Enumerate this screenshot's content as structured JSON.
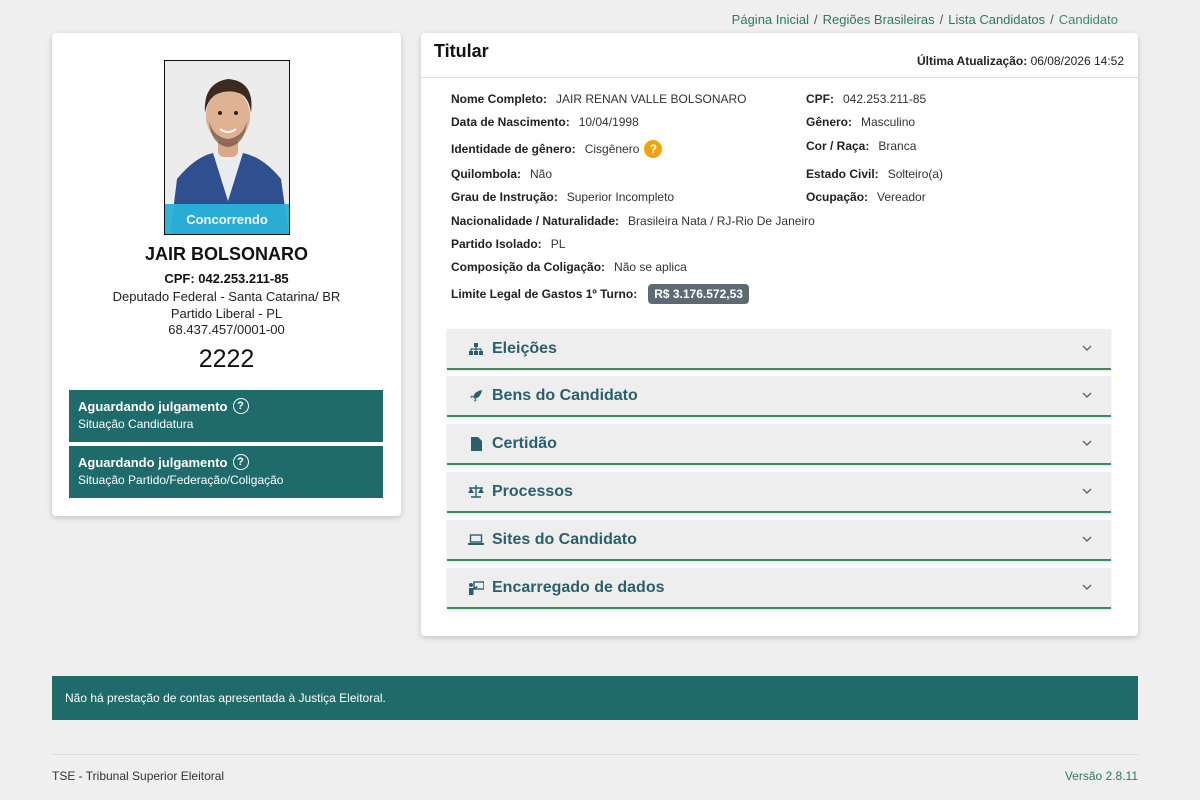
{
  "breadcrumb": {
    "items": [
      "Página Inicial",
      "Regiões Brasileiras",
      "Lista Candidatos",
      "Candidato"
    ],
    "separator": "/"
  },
  "profile": {
    "photo_badge": "Concorrendo",
    "name": "JAIR BOLSONARO",
    "cpf": "CPF: 042.253.211-85",
    "office": "Deputado Federal - Santa Catarina/ BR",
    "party": "Partido Liberal - PL",
    "cnpj": "68.437.457/0001-00",
    "number": "2222",
    "status": [
      {
        "title": "Aguardando julgamento",
        "subtitle": "Situação Candidatura"
      },
      {
        "title": "Aguardando julgamento",
        "subtitle": "Situação Partido/Federação/Coligação"
      }
    ],
    "status_color": "#1f6b6b",
    "badge_color": "#29b3d9"
  },
  "details": {
    "title": "Titular",
    "last_update_label": "Última Atualização:",
    "last_update_value": "06/08/2026 14:52",
    "fields": {
      "nome": {
        "label": "Nome Completo:",
        "value": "JAIR RENAN VALLE BOLSONARO"
      },
      "cpf": {
        "label": "CPF:",
        "value": "042.253.211-85"
      },
      "nascimento": {
        "label": "Data de Nascimento:",
        "value": "10/04/1998"
      },
      "genero": {
        "label": "Gênero:",
        "value": "Masculino"
      },
      "identidade": {
        "label": "Identidade de gênero:",
        "value": "Cisgênero"
      },
      "cor": {
        "label": "Cor / Raça:",
        "value": "Branca"
      },
      "quilombola": {
        "label": "Quilombola:",
        "value": "Não"
      },
      "estado_civil": {
        "label": "Estado Civil:",
        "value": "Solteiro(a)"
      },
      "instrucao": {
        "label": "Grau de Instrução:",
        "value": "Superior Incompleto"
      },
      "ocupacao": {
        "label": "Ocupação:",
        "value": "Vereador"
      },
      "nacionalidade": {
        "label": "Nacionalidade / Naturalidade:",
        "value": "Brasileira Nata / RJ-Rio De Janeiro"
      },
      "partido_isolado": {
        "label": "Partido Isolado:",
        "value": "PL"
      },
      "coligacao": {
        "label": "Composição da Coligação:",
        "value": "Não se aplica"
      },
      "limite": {
        "label": "Limite Legal de Gastos 1º Turno:",
        "value": "R$ 3.176.572,53"
      }
    },
    "help_icon": "?",
    "sections": [
      {
        "label": "Eleições",
        "icon": "sitemap-icon"
      },
      {
        "label": "Bens do Candidato",
        "icon": "rocket-icon"
      },
      {
        "label": "Certidão",
        "icon": "file-icon"
      },
      {
        "label": "Processos",
        "icon": "scale-icon"
      },
      {
        "label": "Sites do Candidato",
        "icon": "laptop-icon"
      },
      {
        "label": "Encarregado de dados",
        "icon": "person-board-icon"
      }
    ]
  },
  "notice": "Não há prestação de contas apresentada à Justiça Eleitoral.",
  "footer": {
    "left": "TSE - Tribunal Superior Eleitoral",
    "right": "Versão 2.8.11"
  },
  "colors": {
    "accent_green": "#3c8b5b",
    "teal": "#1f6b6b",
    "link": "#2c7a5b",
    "help": "#f0a30a"
  }
}
